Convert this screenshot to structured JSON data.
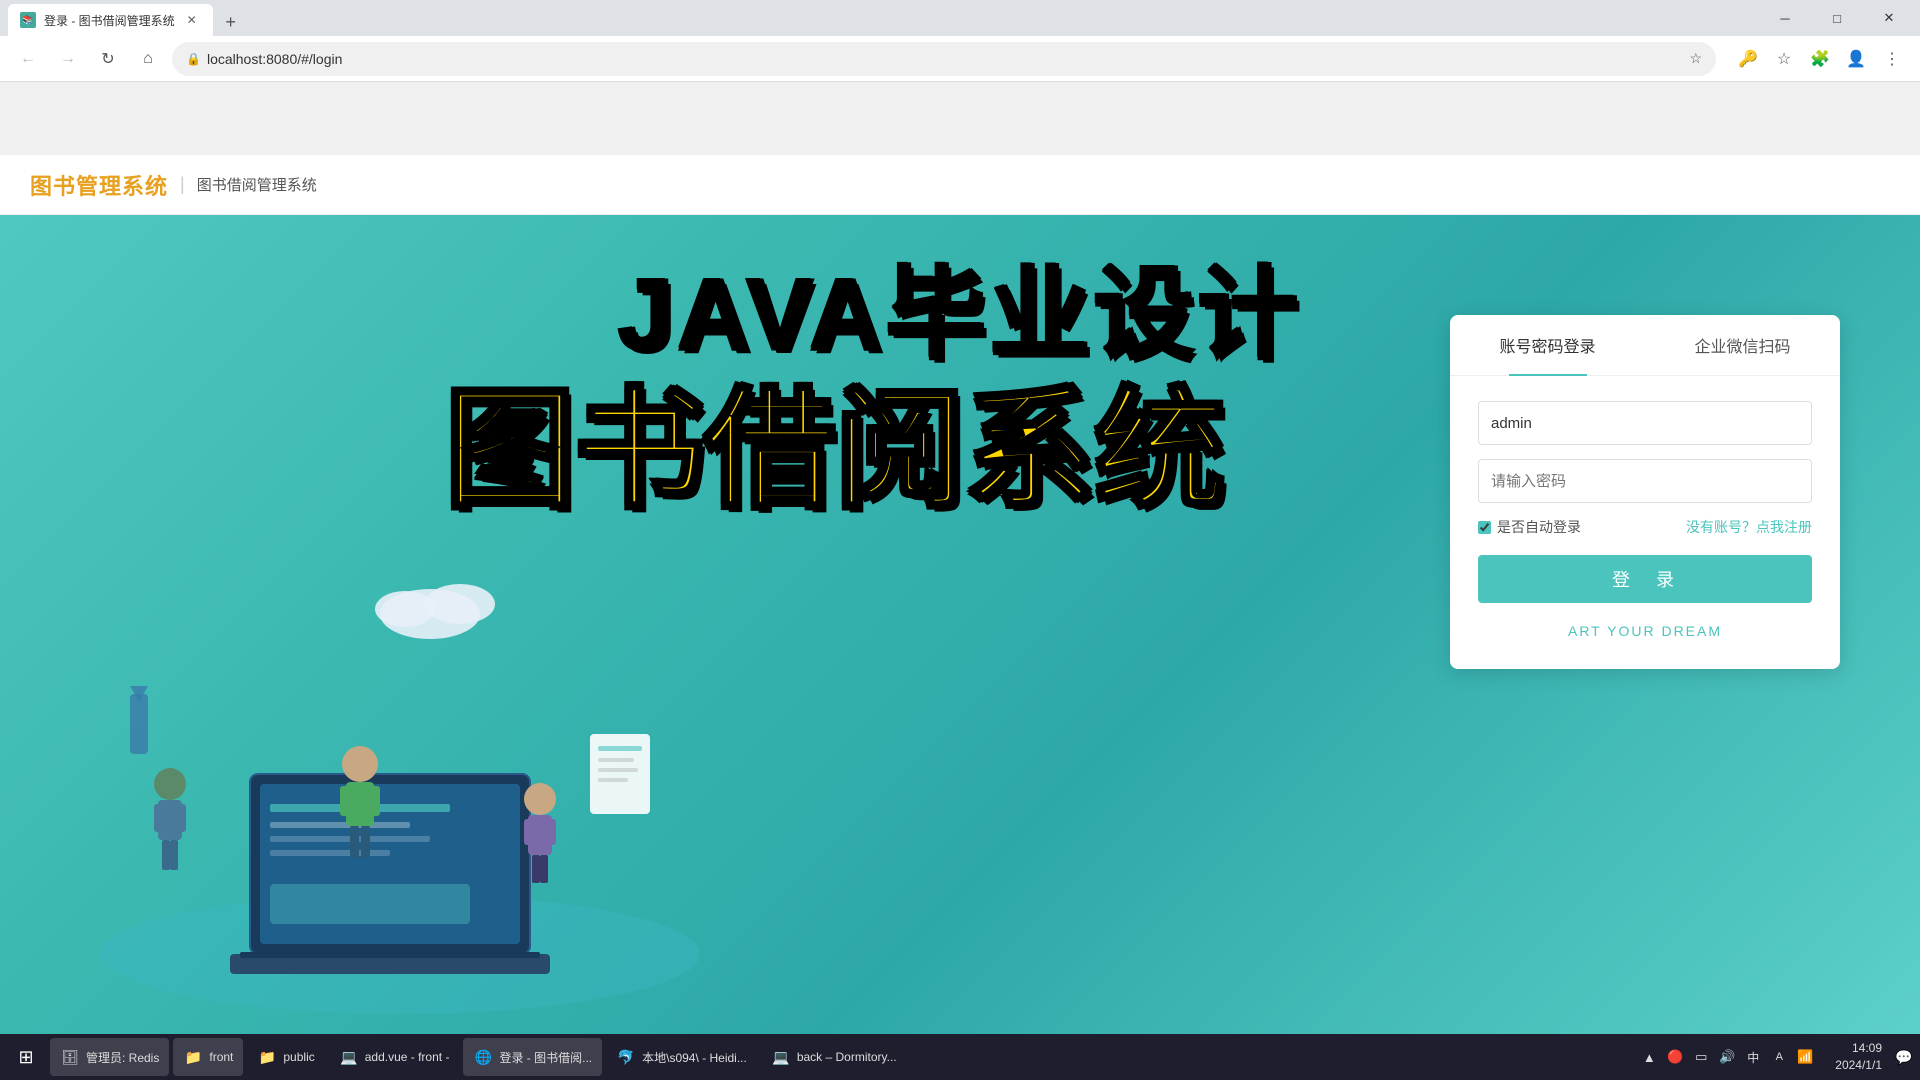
{
  "browser": {
    "tab_title": "登录 - 图书借阅管理系统",
    "url": "localhost:8080/#/login",
    "new_tab_label": "+",
    "back_btn": "←",
    "forward_btn": "→",
    "refresh_btn": "↻",
    "home_btn": "⌂"
  },
  "app_header": {
    "logo": "图书管理系统",
    "divider": "|",
    "subtitle": "图书借阅管理系统"
  },
  "hero": {
    "title_en": "JAVA毕业设计",
    "title_cn": "图书借阅系统"
  },
  "login_card": {
    "tab_password": "账号密码登录",
    "tab_wechat": "企业微信扫码",
    "username_placeholder": "admin",
    "password_placeholder": "请输入密码",
    "auto_login_label": "是否自动登录",
    "register_text": "没有账号？点我注册",
    "login_btn": "登　录",
    "dream_text": "ART YOUR DREAM"
  },
  "taskbar": {
    "start_icon": "⊞",
    "items": [
      {
        "id": "redis",
        "icon": "🗄",
        "label": "管理员: Redis"
      },
      {
        "id": "front",
        "icon": "📁",
        "label": "front"
      },
      {
        "id": "public",
        "icon": "📁",
        "label": "public"
      },
      {
        "id": "add-vue",
        "icon": "💻",
        "label": "add.vue - front -"
      },
      {
        "id": "chrome",
        "icon": "🌐",
        "label": "登录 - 图书借阅管..."
      },
      {
        "id": "heidisql",
        "icon": "🐬",
        "label": "本地\\s094\\ - Heidi..."
      },
      {
        "id": "back",
        "icon": "💻",
        "label": "back – Dormitory..."
      }
    ],
    "tray_icons": [
      "🔴",
      "⬜",
      "🔋",
      "🔊",
      "中",
      "🌐"
    ],
    "ime": "中",
    "clock_time": "14:09",
    "clock_date": "2024/1/1",
    "notification_icons": [
      "▲",
      "🔊",
      "🌐"
    ]
  },
  "colors": {
    "teal": "#4ac4bc",
    "gold": "#FFD700",
    "dark": "#1e1e2e",
    "logo_color": "#e8a020"
  }
}
